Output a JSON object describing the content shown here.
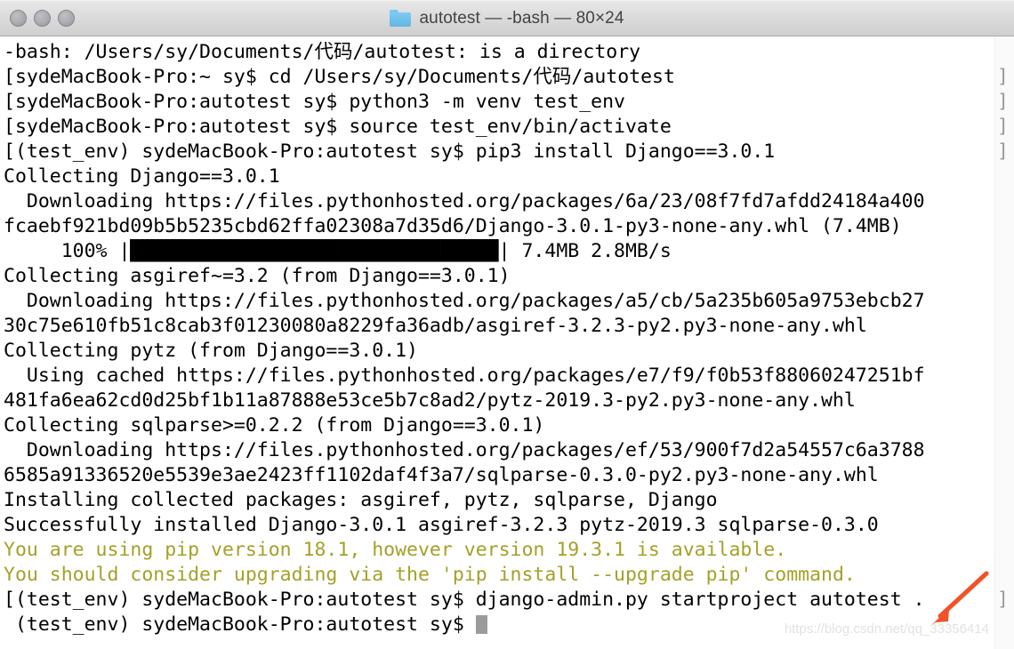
{
  "window": {
    "title": "autotest — -bash — 80×24",
    "folder_icon": "folder-icon",
    "traffic_lights": [
      {
        "name": "close-button",
        "color": "#a9a9ae"
      },
      {
        "name": "minimize-button",
        "color": "#a9a9ae"
      },
      {
        "name": "zoom-button",
        "color": "#a9a9ae"
      }
    ]
  },
  "theme": {
    "background": "#ffffff",
    "foreground": "#000000",
    "warning": "#a3a127",
    "cursor": "#9b9b9b",
    "bracket": "#9a9a9a",
    "arrow": "#f0522a",
    "titlebar": "#dcdcdc",
    "folder": "#6fc0ec"
  },
  "terminal": {
    "cols": 80,
    "rows": 24,
    "shell": "-bash",
    "cwd_name": "autotest",
    "cursor_visible": true,
    "lines": [
      {
        "id": "l1",
        "text": "-bash: /Users/sy/Documents/代码/autotest: is a directory",
        "color": "fg",
        "right_bracket": false
      },
      {
        "id": "l2",
        "text": "[sydeMacBook-Pro:~ sy$ cd /Users/sy/Documents/代码/autotest",
        "color": "fg",
        "right_bracket": true
      },
      {
        "id": "l3",
        "text": "[sydeMacBook-Pro:autotest sy$ python3 -m venv test_env",
        "color": "fg",
        "right_bracket": true
      },
      {
        "id": "l4",
        "text": "[sydeMacBook-Pro:autotest sy$ source test_env/bin/activate",
        "color": "fg",
        "right_bracket": true
      },
      {
        "id": "l5",
        "text": "[(test_env) sydeMacBook-Pro:autotest sy$ pip3 install Django==3.0.1",
        "color": "fg",
        "right_bracket": true
      },
      {
        "id": "l6",
        "text": "Collecting Django==3.0.1",
        "color": "fg",
        "right_bracket": false
      },
      {
        "id": "l7",
        "text": "  Downloading https://files.pythonhosted.org/packages/6a/23/08f7fd7afdd24184a400",
        "color": "fg",
        "right_bracket": false
      },
      {
        "id": "l8",
        "text": "fcaebf921bd09b5b5235cbd62ffa02308a7d35d6/Django-3.0.1-py3-none-any.whl (7.4MB)",
        "color": "fg",
        "right_bracket": false
      },
      {
        "id": "l9",
        "text": "     100% |████████████████████████████████| 7.4MB 2.8MB/s",
        "color": "fg",
        "right_bracket": false
      },
      {
        "id": "l10",
        "text": "Collecting asgiref~=3.2 (from Django==3.0.1)",
        "color": "fg",
        "right_bracket": false
      },
      {
        "id": "l11",
        "text": "  Downloading https://files.pythonhosted.org/packages/a5/cb/5a235b605a9753ebcb27",
        "color": "fg",
        "right_bracket": false
      },
      {
        "id": "l12",
        "text": "30c75e610fb51c8cab3f01230080a8229fa36adb/asgiref-3.2.3-py2.py3-none-any.whl",
        "color": "fg",
        "right_bracket": false
      },
      {
        "id": "l13",
        "text": "Collecting pytz (from Django==3.0.1)",
        "color": "fg",
        "right_bracket": false
      },
      {
        "id": "l14",
        "text": "  Using cached https://files.pythonhosted.org/packages/e7/f9/f0b53f88060247251bf",
        "color": "fg",
        "right_bracket": false
      },
      {
        "id": "l15",
        "text": "481fa6ea62cd0d25bf1b11a87888e53ce5b7c8ad2/pytz-2019.3-py2.py3-none-any.whl",
        "color": "fg",
        "right_bracket": false
      },
      {
        "id": "l16",
        "text": "Collecting sqlparse>=0.2.2 (from Django==3.0.1)",
        "color": "fg",
        "right_bracket": false
      },
      {
        "id": "l17",
        "text": "  Downloading https://files.pythonhosted.org/packages/ef/53/900f7d2a54557c6a3788",
        "color": "fg",
        "right_bracket": false
      },
      {
        "id": "l18",
        "text": "6585a91336520e5539e3ae2423ff1102daf4f3a7/sqlparse-0.3.0-py2.py3-none-any.whl",
        "color": "fg",
        "right_bracket": false
      },
      {
        "id": "l19",
        "text": "Installing collected packages: asgiref, pytz, sqlparse, Django",
        "color": "fg",
        "right_bracket": false
      },
      {
        "id": "l20",
        "text": "Successfully installed Django-3.0.1 asgiref-3.2.3 pytz-2019.3 sqlparse-0.3.0",
        "color": "fg",
        "right_bracket": false
      },
      {
        "id": "l21",
        "text": "You are using pip version 18.1, however version 19.3.1 is available.",
        "color": "warn",
        "right_bracket": false
      },
      {
        "id": "l22",
        "text": "You should consider upgrading via the 'pip install --upgrade pip' command.",
        "color": "warn",
        "right_bracket": false
      },
      {
        "id": "l23",
        "text": "[(test_env) sydeMacBook-Pro:autotest sy$ django-admin.py startproject autotest .",
        "color": "fg",
        "right_bracket": true
      },
      {
        "id": "l24",
        "text": " (test_env) sydeMacBook-Pro:autotest sy$ ",
        "color": "fg",
        "right_bracket": false
      }
    ]
  },
  "annotation": {
    "arrow_name": "red-arrow-annotation",
    "arrow_color": "#f0522a"
  },
  "watermark": {
    "text": "https://blog.csdn.net/qq_33356414"
  }
}
